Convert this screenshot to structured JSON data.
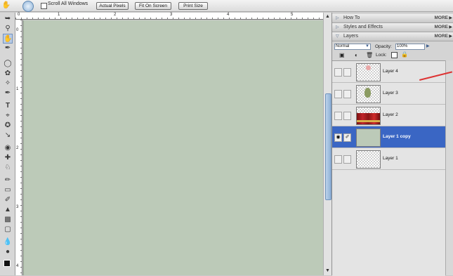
{
  "options_bar": {
    "scroll_all_windows_label": "Scroll All Windows",
    "actual_pixels_label": "Actual Pixels",
    "fit_on_screen_label": "Fit On Screen",
    "print_size_label": "Print Size"
  },
  "ruler": {
    "h_numbers": [
      "0",
      "1",
      "2",
      "3",
      "4",
      "5"
    ],
    "v_numbers": [
      "0",
      "1",
      "2",
      "3",
      "4"
    ]
  },
  "panel": {
    "tabs": [
      {
        "label": "How To",
        "more": "MORE"
      },
      {
        "label": "Styles and Effects",
        "more": "MORE"
      },
      {
        "label": "Layers",
        "more": "MORE"
      }
    ],
    "blend_mode": "Normal",
    "opacity_label": "Opacity:",
    "opacity_value": "100%",
    "lock_label": "Lock:"
  },
  "layers": [
    {
      "name": "Layer 4",
      "thumb": "pink flower"
    },
    {
      "name": "Layer 3",
      "thumb": "green leaf"
    },
    {
      "name": "Layer 2",
      "thumb": "red roses"
    },
    {
      "name": "Layer 1 copy",
      "thumb": "green fill",
      "selected": true
    },
    {
      "name": "Layer 1",
      "thumb": "transparent"
    }
  ],
  "colors": {
    "canvas": "#bccab8",
    "selection": "#3a66c4",
    "annotation_line": "#d33333"
  }
}
